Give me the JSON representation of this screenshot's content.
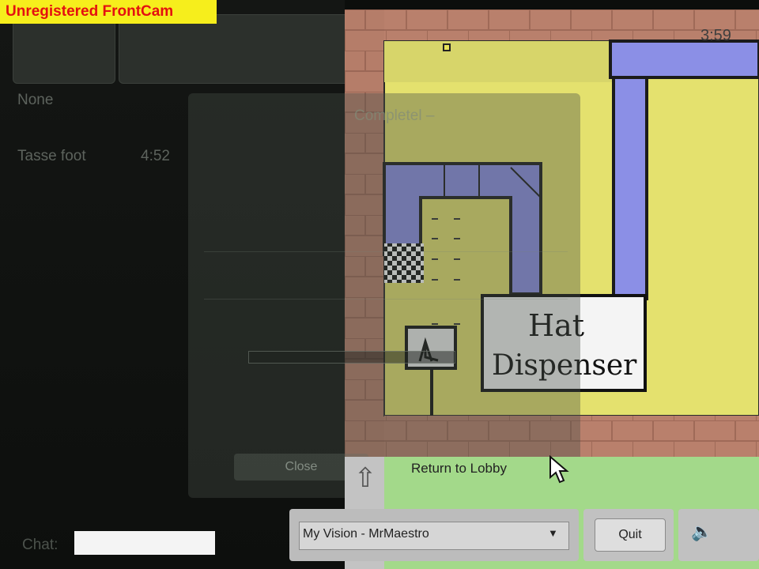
{
  "watermark": "Unregistered FrontCam",
  "scores": {
    "rows": [
      {
        "name": "None",
        "time": ""
      },
      {
        "name": "Tasse foot",
        "time": "4:52"
      }
    ]
  },
  "dialog": {
    "title": "Completel –",
    "close_label": "Close"
  },
  "game": {
    "timer": "3:59",
    "sign_line1": "Hat",
    "sign_line2": "Dispenser"
  },
  "controls": {
    "return_lobby": "Return to Lobby",
    "vision_select": "My Vision - MrMaestro",
    "quit_label": "Quit"
  },
  "chat": {
    "label": "Chat:",
    "value": ""
  },
  "icons": {
    "up_arrow": "up-arrow-icon",
    "dropdown": "chevron-down-icon",
    "sound": "speaker-icon",
    "cursor": "mouse-cursor-icon"
  },
  "colors": {
    "floor_yellow": "#e4e16e",
    "pipe_blue": "#8b8fe6",
    "brick": "#b9806c",
    "lobby_green": "#a3d98a",
    "watermark_bg": "#f6ee1c",
    "watermark_text": "#e41010"
  }
}
